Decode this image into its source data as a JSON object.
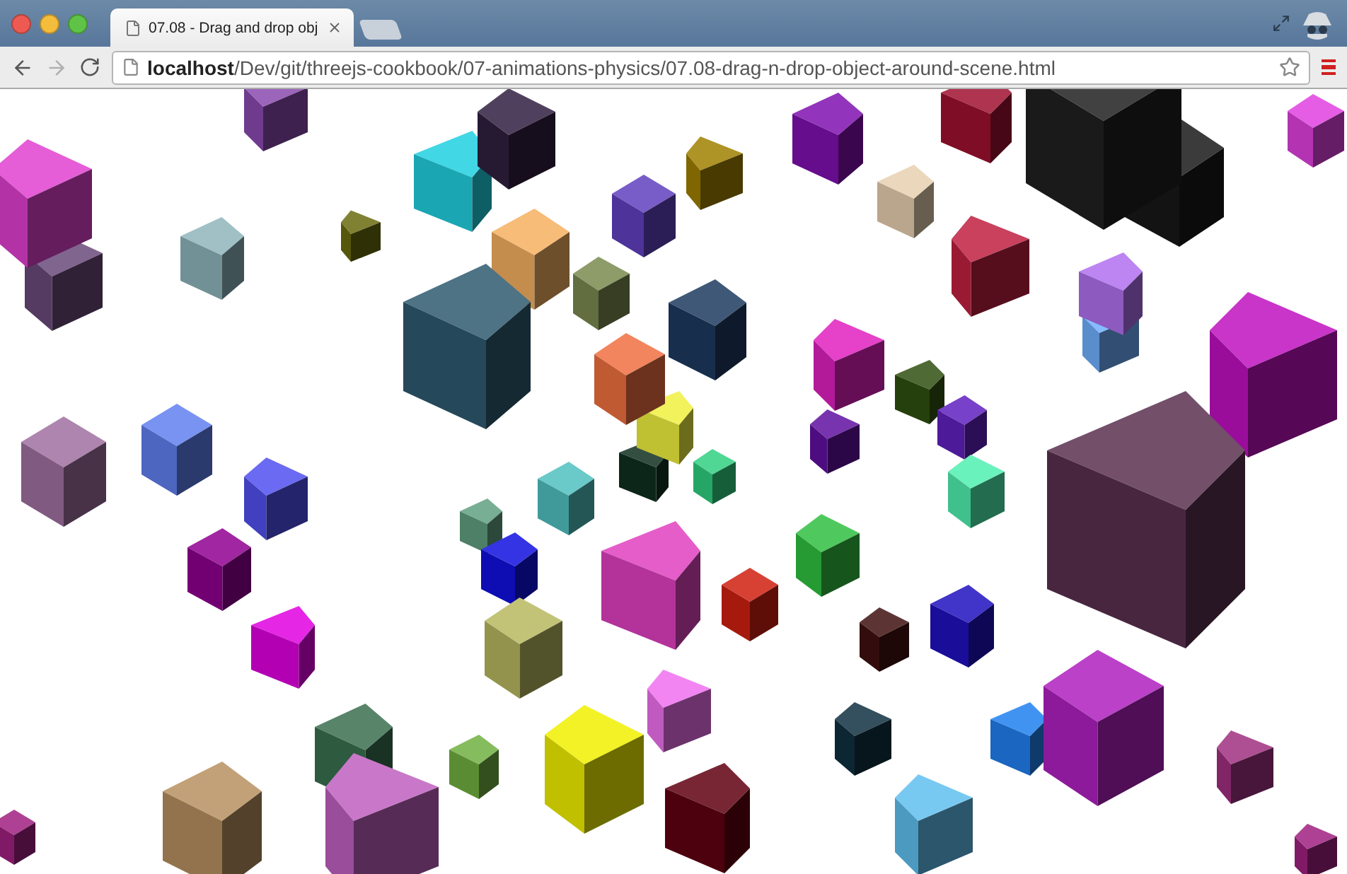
{
  "tab": {
    "title": "07.08 - Drag and drop obj",
    "selected": true
  },
  "toolbar": {
    "back_disabled": false,
    "forward_disabled": true
  },
  "address_bar": {
    "url": "**localhost**/Dev/git/threejs-cookbook/07-animations-physics/07.08-drag-n-drop-object-around-scene.html"
  }
}
